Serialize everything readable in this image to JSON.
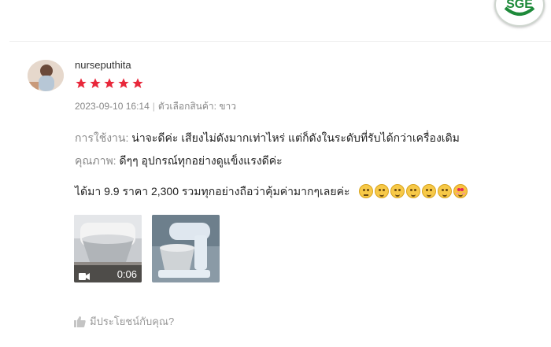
{
  "logo": {
    "text": "SGE"
  },
  "review": {
    "username": "nurseputhita",
    "rating": 5,
    "datetime": "2023-09-10 16:14",
    "variation_label": "ตัวเลือกสินค้า:",
    "variation_value": "ขาว",
    "usage_label": "การใช้งาน:",
    "usage_text": "น่าจะดีค่ะ เสียงไม่ดังมากเท่าไหร่ แต่ก็ดังในระดับที่รับได้กว่าเครื่องเดิม",
    "quality_label": "คุณภาพ:",
    "quality_text": "ดีๆๆ อุปกรณ์ทุกอย่างดูแข็งแรงดีค่ะ",
    "comment": "ได้มา 9.9 ราคา 2,300 รวมทุกอย่างถือว่าคุ้มค่ามากๆเลยค่ะ",
    "emojis": [
      "neutral-face",
      "smiling-face",
      "smiling-face",
      "smiling-face",
      "smiling-face",
      "smiling-face",
      "heart-eyes-face"
    ],
    "media": [
      {
        "type": "video",
        "duration": "0:06"
      },
      {
        "type": "image"
      }
    ],
    "helpful_text": "มีประโยชน์กับคุณ?"
  },
  "colors": {
    "star": "#e8273a",
    "label": "#8a8a8a",
    "meta": "#888888"
  }
}
